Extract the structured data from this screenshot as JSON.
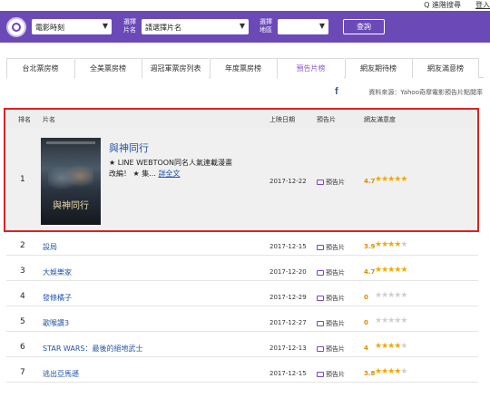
{
  "topbar": {
    "search_label": "Q 進階搜尋",
    "login_label": "登入"
  },
  "filters": {
    "category_value": "電影時刻",
    "label_movie": "選擇片名",
    "movie_value": "請選擇片名",
    "label_theater": "選擇地區",
    "theater_value": "",
    "query_label": "查詢"
  },
  "tabs": [
    "台北票房榜",
    "全美票房榜",
    "週冠軍票房列表",
    "年度票房榜",
    "預告片榜",
    "網友期待榜",
    "網友滿意榜"
  ],
  "active_tab": "預告片榜",
  "source_text": "資料來源：Yahoo奇摩電影預告片點閱率",
  "table_headers": {
    "rank": "排名",
    "name": "片名",
    "release": "上映日期",
    "trailer": "預告片",
    "rating": "網友滿意度"
  },
  "featured": {
    "rank": "1",
    "title": "與神同行",
    "poster_text": "與神同行",
    "desc_line1": "★ LINE WEBTOON同名人氣連載漫畫",
    "desc_line2": "改編！ ★ 集...",
    "more": "詳全文",
    "date": "2017-12-22",
    "trailer": "預告片",
    "score": "4.7",
    "stars": 4.7
  },
  "rows": [
    {
      "rank": "2",
      "title": "設局",
      "date": "2017-12-15",
      "trailer": "預告片",
      "score": "3.9",
      "stars": 3.9
    },
    {
      "rank": "3",
      "title": "大娛樂家",
      "date": "2017-12-20",
      "trailer": "預告片",
      "score": "4.7",
      "stars": 4.7
    },
    {
      "rank": "4",
      "title": "發條橘子",
      "date": "2017-12-29",
      "trailer": "預告片",
      "score": "0",
      "stars": 0
    },
    {
      "rank": "5",
      "title": "歌喉讚3",
      "date": "2017-12-27",
      "trailer": "預告片",
      "score": "0",
      "stars": 0
    },
    {
      "rank": "6",
      "title": "STAR WARS：最後的絕地武士",
      "date": "2017-12-13",
      "trailer": "預告片",
      "score": "4",
      "stars": 4
    },
    {
      "rank": "7",
      "title": "逃出亞馬遜",
      "date": "2017-12-15",
      "trailer": "預告片",
      "score": "3.8",
      "stars": 3.8
    }
  ],
  "colors": {
    "brand_purple": "#6b4ab8",
    "link_blue": "#2255aa",
    "star_gold": "#f3a800",
    "highlight_red": "#e02020"
  }
}
